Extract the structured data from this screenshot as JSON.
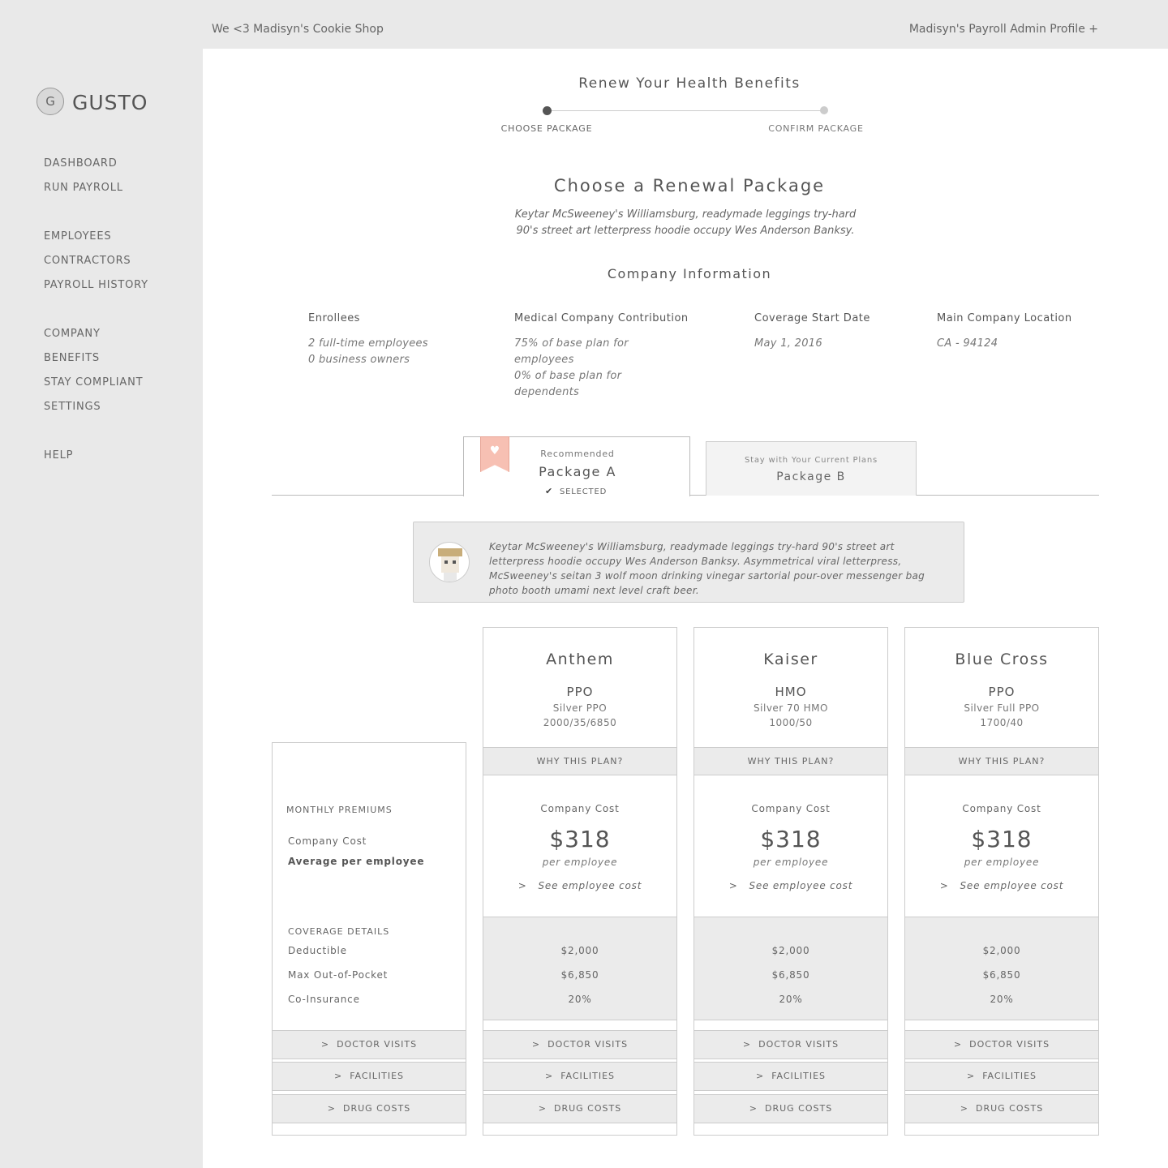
{
  "header": {
    "shop_name": "We <3 Madisyn's Cookie Shop",
    "profile": "Madisyn's Payroll Admin Profile +"
  },
  "sidebar": {
    "logo_letter": "G",
    "logo_text": "GUSTO",
    "items": [
      "DASHBOARD",
      "RUN PAYROLL",
      "EMPLOYEES",
      "CONTRACTORS",
      "PAYROLL HISTORY",
      "COMPANY",
      "BENEFITS",
      "STAY COMPLIANT",
      "SETTINGS",
      "HELP"
    ]
  },
  "page": {
    "title": "Renew Your Health Benefits",
    "steps": [
      "CHOOSE PACKAGE",
      "CONFIRM PACKAGE"
    ],
    "heading": "Choose a Renewal Package",
    "intro": "Keytar McSweeney's Williamsburg, readymade leggings try-hard 90's street art letterpress hoodie occupy Wes Anderson Banksy.",
    "company_info_title": "Company Information"
  },
  "company_info": {
    "enrollees_label": "Enrollees",
    "enrollees_line1": "2 full-time employees",
    "enrollees_line2": "0 business owners",
    "contribution_label": "Medical Company Contribution",
    "contribution_line1": "75% of base plan for employees",
    "contribution_line2": "0% of base plan for dependents",
    "start_label": "Coverage Start Date",
    "start_value": "May 1, 2016",
    "location_label": "Main Company Location",
    "location_value": "CA - 94124"
  },
  "tabs": {
    "a_sub": "Recommended",
    "a_title": "Package A",
    "a_selected": "SELECTED",
    "b_sub": "Stay with Your Current Plans",
    "b_title": "Package B"
  },
  "advisor": {
    "text": "Keytar McSweeney's Williamsburg, readymade leggings try-hard 90's street art letterpress hoodie occupy Wes Anderson Banksy. Asymmetrical viral letterpress, McSweeney's seitan 3 wolf moon drinking vinegar sartorial pour-over messenger bag photo booth umami next level craft beer."
  },
  "labels": {
    "monthly_premiums": "MONTHLY PREMIUMS",
    "company_cost": "Company Cost",
    "avg_per_employee": "Average per employee",
    "coverage_details": "COVERAGE DETAILS",
    "deductible": "Deductible",
    "max_oop": "Max Out-of-Pocket",
    "coinsurance": "Co-Insurance"
  },
  "accordions": {
    "doctor": "DOCTOR VISITS",
    "facilities": "FACILITIES",
    "drug": "DRUG COSTS",
    "chevron": ">"
  },
  "plans": [
    {
      "name": "Anthem",
      "type": "PPO",
      "line1": "Silver PPO",
      "line2": "2000/35/6850",
      "why": "WHY THIS PLAN?",
      "cost_label": "Company Cost",
      "cost": "$318",
      "per": "per employee",
      "see": "See employee cost",
      "deductible": "$2,000",
      "max_oop": "$6,850",
      "coinsurance": "20%"
    },
    {
      "name": "Kaiser",
      "type": "HMO",
      "line1": "Silver 70 HMO",
      "line2": "1000/50",
      "why": "WHY THIS PLAN?",
      "cost_label": "Company Cost",
      "cost": "$318",
      "per": "per employee",
      "see": "See employee cost",
      "deductible": "$2,000",
      "max_oop": "$6,850",
      "coinsurance": "20%"
    },
    {
      "name": "Blue Cross",
      "type": "PPO",
      "line1": "Silver Full PPO",
      "line2": "1700/40",
      "why": "WHY THIS PLAN?",
      "cost_label": "Company Cost",
      "cost": "$318",
      "per": "per employee",
      "see": "See employee cost",
      "deductible": "$2,000",
      "max_oop": "$6,850",
      "coinsurance": "20%"
    }
  ],
  "icons": {
    "heart": "heart-icon",
    "check": "check-icon",
    "chevron": "chevron-right-icon",
    "avatar": "advisor-avatar"
  },
  "colors": {
    "ribbon": "#f7c0b3",
    "sidebar_bg": "#e9e9e9",
    "panel_gray": "#ebebeb"
  }
}
